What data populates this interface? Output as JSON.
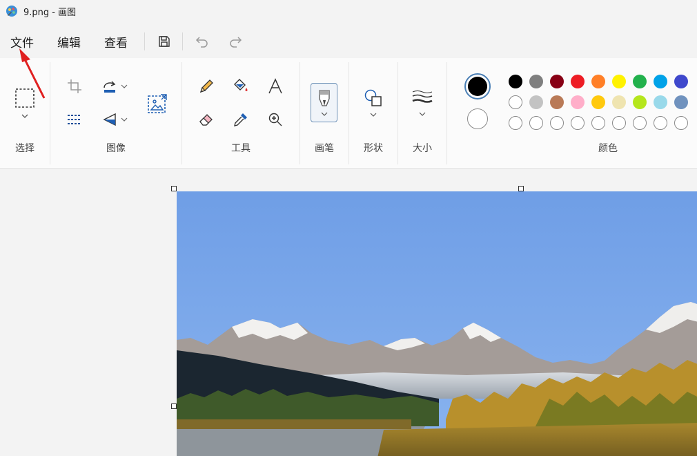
{
  "window": {
    "title": "9.png - 画图"
  },
  "menu": {
    "file": "文件",
    "edit": "编辑",
    "view": "查看"
  },
  "quick": {
    "save_icon": "save-icon",
    "undo_icon": "undo-icon",
    "redo_icon": "redo-icon"
  },
  "ribbon": {
    "groups": {
      "select": "选择",
      "image": "图像",
      "tools": "工具",
      "brushes": "画笔",
      "shapes": "形状",
      "size": "大小",
      "colors": "颜色"
    }
  },
  "colors": {
    "primary": "#000000",
    "secondary": "#ffffff",
    "row1": [
      "#000000",
      "#7f7f7f",
      "#880015",
      "#ed1c24",
      "#ff7f27",
      "#fff200",
      "#22b14c",
      "#00a2e8",
      "#3f48cc"
    ],
    "row2": [
      "#ffffff",
      "#c3c3c3",
      "#b97a57",
      "#ffaec9",
      "#ffc90e",
      "#efe4b0",
      "#b5e61d",
      "#99d9ea",
      "#7092be"
    ]
  },
  "accent": "#0067c0"
}
